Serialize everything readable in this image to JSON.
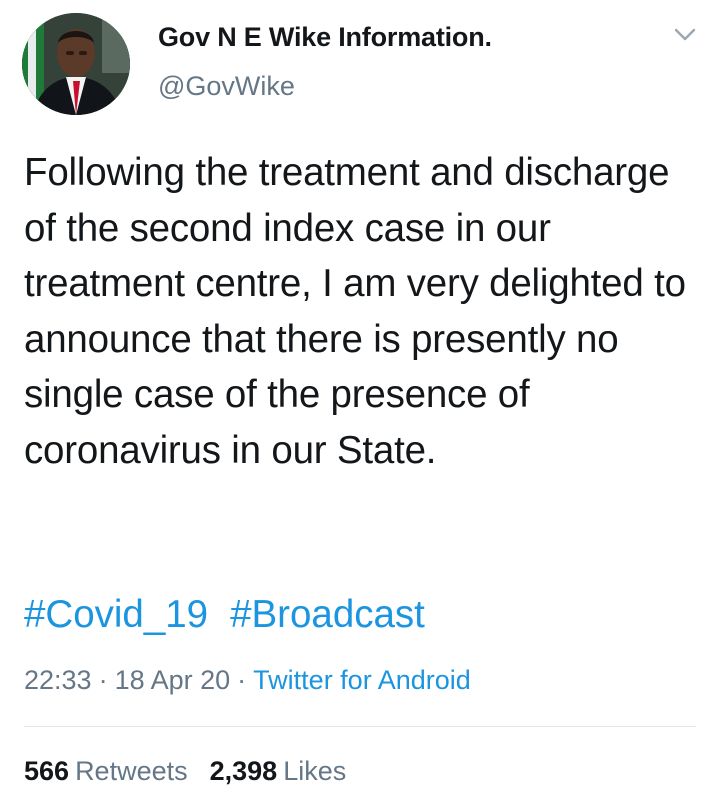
{
  "tweet": {
    "author": {
      "display_name": "Gov N E Wike Information.",
      "handle": "@GovWike"
    },
    "text": "Following the treatment and discharge of the second index case in our treatment centre, I am very delighted to announce that there is presently no single case of the presence of coronavirus in our State.",
    "hashtags": [
      "#Covid_19",
      "#Broadcast"
    ],
    "time": "22:33",
    "date": "18 Apr 20",
    "separator": "·",
    "source": "Twitter for Android",
    "stats": {
      "retweets_count": "566",
      "retweets_label": "Retweets",
      "likes_count": "2,398",
      "likes_label": "Likes"
    }
  },
  "icons": {
    "menu": "chevron-down-icon"
  },
  "colors": {
    "link": "#1b95e0",
    "secondary_text": "#657786",
    "primary_text": "#14171a",
    "divider": "#e1e8ed"
  }
}
